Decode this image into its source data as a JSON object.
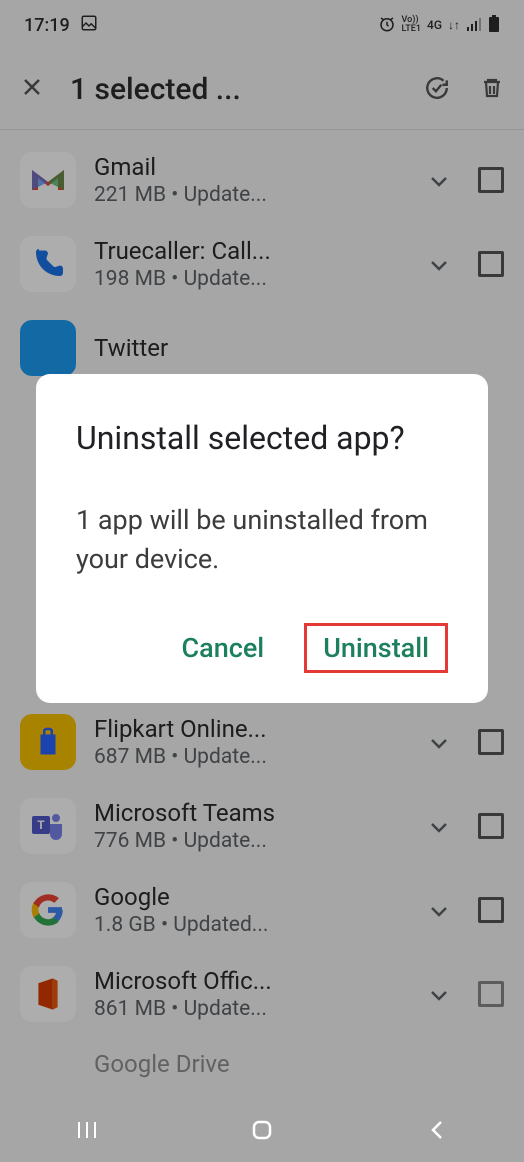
{
  "status": {
    "time": "17:19",
    "network": "4G",
    "lte": "LTE1",
    "vo": "Vo))"
  },
  "header": {
    "title": "1 selected  ..."
  },
  "apps": [
    {
      "name": "Gmail",
      "size": "221 MB",
      "status": "Update..."
    },
    {
      "name": "Truecaller: Call...",
      "size": "198 MB",
      "status": "Update..."
    },
    {
      "name": "Twitter",
      "size": "",
      "status": ""
    },
    {
      "name": "Flipkart Online...",
      "size": "687 MB",
      "status": "Update..."
    },
    {
      "name": "Microsoft Teams",
      "size": "776 MB",
      "status": "Update..."
    },
    {
      "name": "Google",
      "size": "1.8 GB",
      "status": "Updated..."
    },
    {
      "name": "Microsoft Offic...",
      "size": "861 MB",
      "status": "Update..."
    },
    {
      "name": "Google Drive",
      "size": "",
      "status": ""
    }
  ],
  "dialog": {
    "title": "Uninstall selected app?",
    "body": "1 app will be uninstalled from your device.",
    "cancel": "Cancel",
    "confirm": "Uninstall"
  }
}
